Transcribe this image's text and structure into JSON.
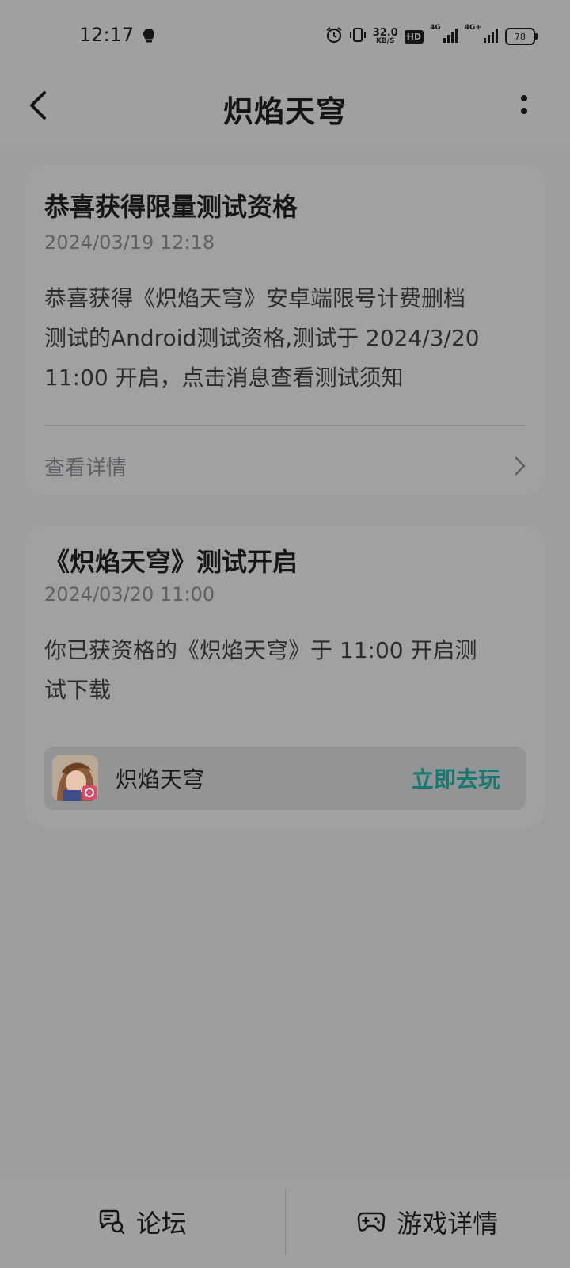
{
  "status_bar": {
    "time": "12:17",
    "net_speed_value": "32.0",
    "net_speed_unit": "KB/S",
    "hd_badge": "HD",
    "signal1_label": "4G",
    "signal2_label": "4G+",
    "battery": "78"
  },
  "header": {
    "title": "炽焰天穹"
  },
  "messages": [
    {
      "title": "恭喜获得限量测试资格",
      "time": "2024/03/19 12:18",
      "body_lines": [
        "恭喜获得《炽焰天穹》安卓端限号计费删档",
        "测试的Android测试资格,测试于 2024/3/20",
        "11:00 开启，点击消息查看测试须知"
      ],
      "link_label": "查看详情"
    },
    {
      "title": "《炽焰天穹》测试开启",
      "time": "2024/03/20 11:00",
      "body_lines": [
        "你已获资格的《炽焰天穹》于 11:00 开启测",
        "试下载"
      ],
      "game_name": "炽焰天穹",
      "play_label": "立即去玩"
    }
  ],
  "tabs": [
    {
      "label": "论坛",
      "icon": "forum-icon"
    },
    {
      "label": "游戏详情",
      "icon": "gamepad-icon"
    }
  ],
  "colors": {
    "accent": "#167a72"
  }
}
